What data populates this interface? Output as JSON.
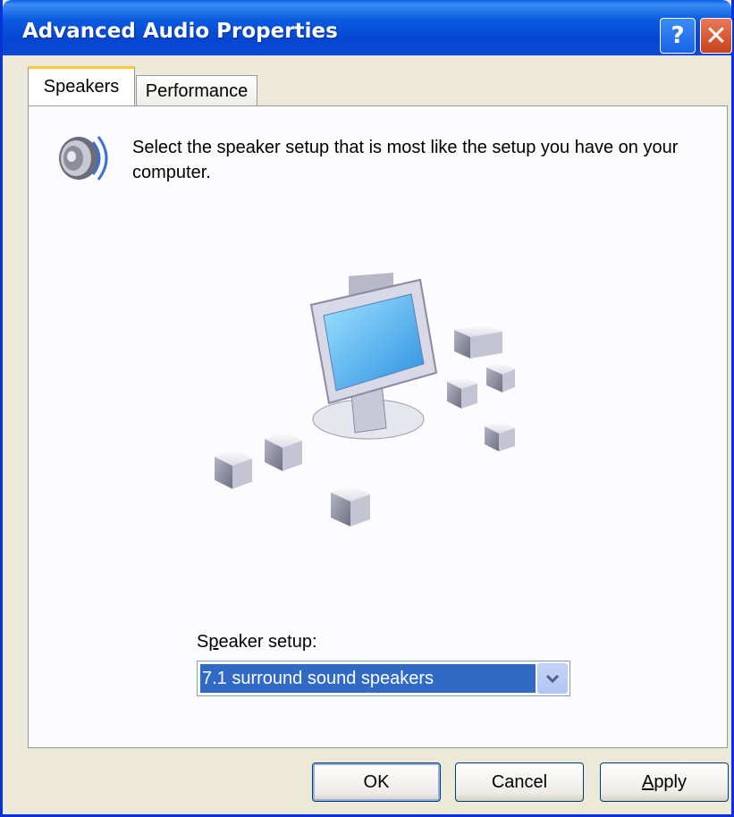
{
  "window": {
    "title": "Advanced Audio Properties",
    "help_glyph": "?",
    "close_glyph": "✕"
  },
  "tabs": [
    {
      "label": "Speakers",
      "active": true
    },
    {
      "label": "Performance",
      "active": false
    }
  ],
  "speakers_tab": {
    "icon": "speaker-icon",
    "description": "Select the speaker setup that is most like the setup you have on your computer.",
    "illustration": "computer-with-7.1-speakers-illustration",
    "setup_label_prefix": "S",
    "setup_label_mnemonic": "p",
    "setup_label_suffix": "eaker setup:",
    "setup_value": "7.1 surround sound speakers"
  },
  "buttons": {
    "ok": "OK",
    "cancel": "Cancel",
    "apply_mnemonic": "A",
    "apply_rest": "pply"
  },
  "colors": {
    "titlebar": "#0a5fe6",
    "selection": "#316ac5",
    "tab_highlight": "#ffc83c",
    "face": "#ece9d8"
  }
}
